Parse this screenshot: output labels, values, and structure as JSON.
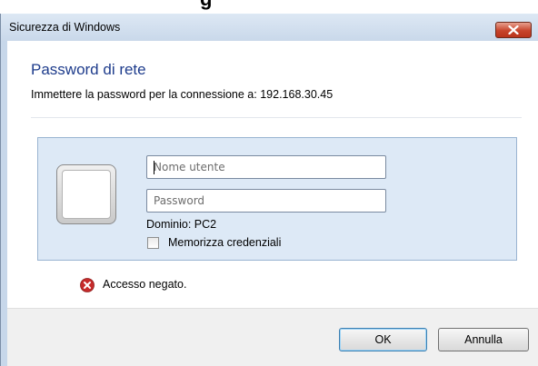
{
  "window": {
    "title": "Sicurezza di Windows",
    "top_fragment": "g"
  },
  "dialog": {
    "heading": "Password di rete",
    "subtitle": "Immettere la password per la connessione a: 192.168.30.45"
  },
  "credentials": {
    "username_placeholder": "Nome utente",
    "password_placeholder": "Password",
    "domain_label": "Dominio: PC2",
    "remember_label": "Memorizza credenziali",
    "remember_checked": false
  },
  "error": {
    "message": "Accesso negato."
  },
  "buttons": {
    "ok_label": "OK",
    "cancel_label": "Annulla"
  },
  "colors": {
    "heading": "#1e3c8c",
    "close_button": "#c7442b",
    "panel_background": "#dde9f6",
    "error_icon": "#c62b2b"
  },
  "icons": {
    "close": "close-icon",
    "error": "error-icon",
    "user_tile": "user-tile-icon"
  }
}
